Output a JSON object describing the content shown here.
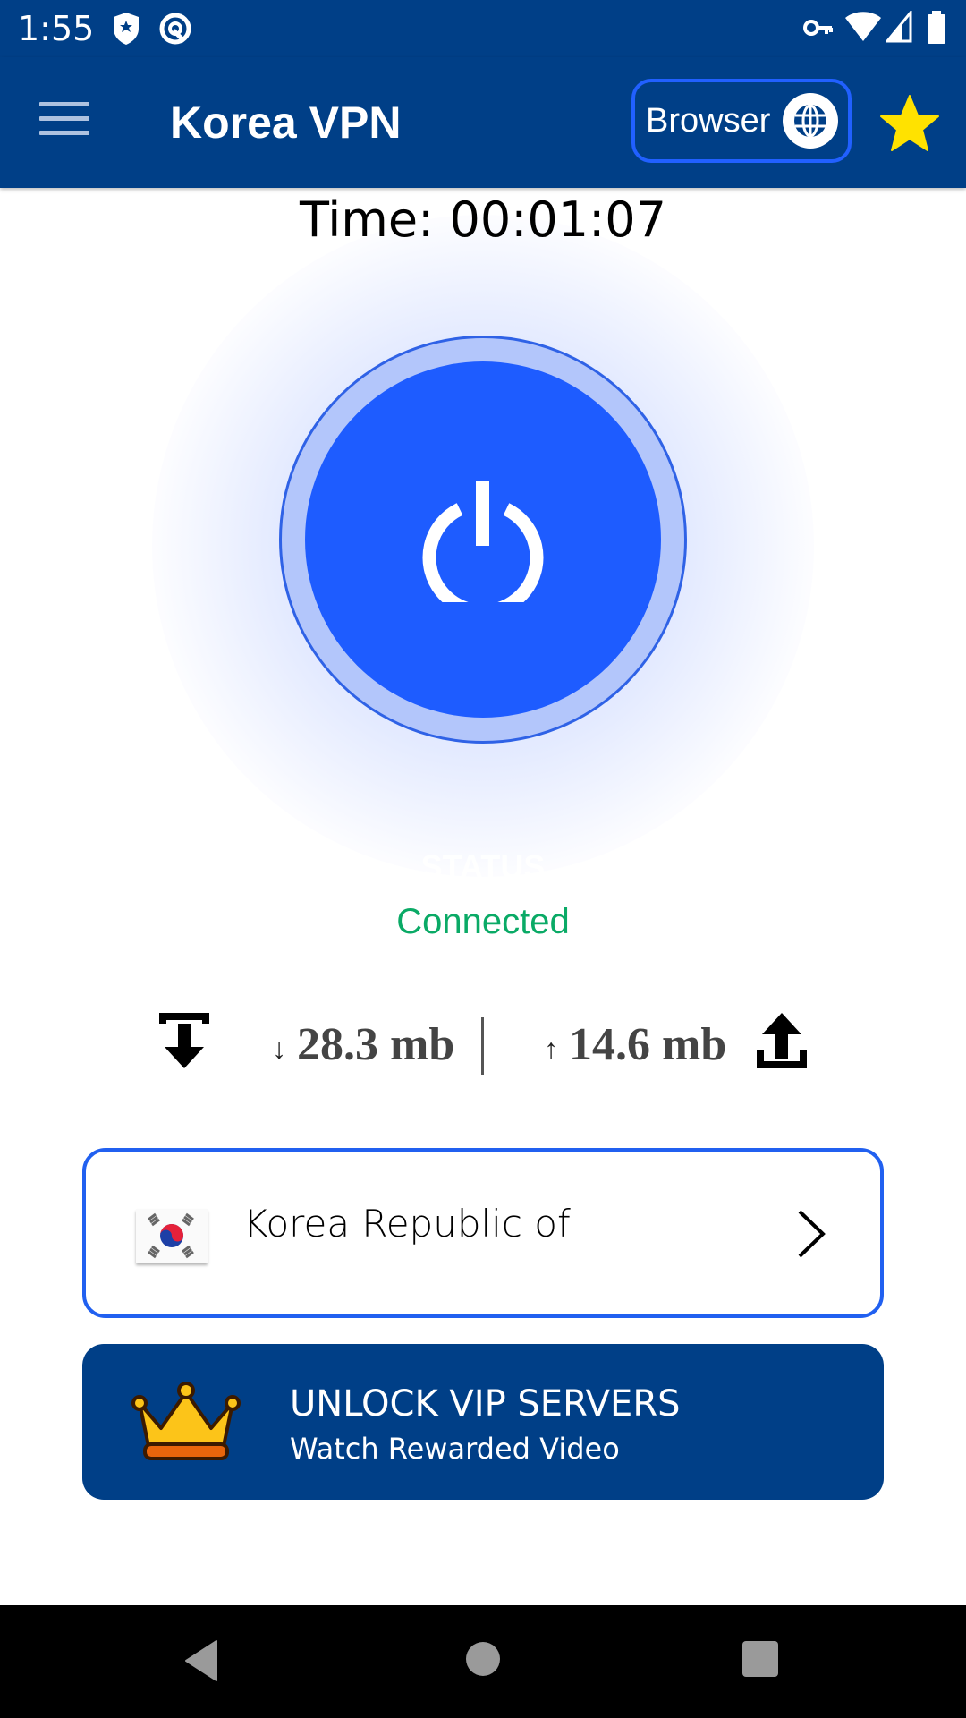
{
  "status_bar": {
    "time": "1:55",
    "left_icons": [
      "shield-notification-icon",
      "at-sign-notification-icon"
    ],
    "right_icons": [
      "vpn-key-icon",
      "wifi-icon",
      "signal-icon",
      "battery-icon"
    ]
  },
  "app_bar": {
    "title": "Korea VPN",
    "browser_label": "Browser",
    "menu_icon": "hamburger-menu-icon",
    "browser_icon": "globe-icon",
    "rate_icon": "star-icon"
  },
  "connection": {
    "timer": "Time: 00:01:07",
    "status_label": "STATUS",
    "status_value": "Connected",
    "status_color": "#0aaa66",
    "power_icon": "power-icon"
  },
  "traffic": {
    "download_arrow": "↓",
    "download": "28.3 mb",
    "upload_arrow": "↑",
    "upload": "14.6 mb"
  },
  "server": {
    "country": "Korea Republic of",
    "flag_icon": "south-korea-flag-icon"
  },
  "vip": {
    "title": "UNLOCK VIP SERVERS",
    "subtitle": "Watch Rewarded Video",
    "icon": "crown-icon"
  },
  "colors": {
    "primary": "#003f87",
    "accent": "#1e5cff",
    "star": "#ffe200"
  }
}
